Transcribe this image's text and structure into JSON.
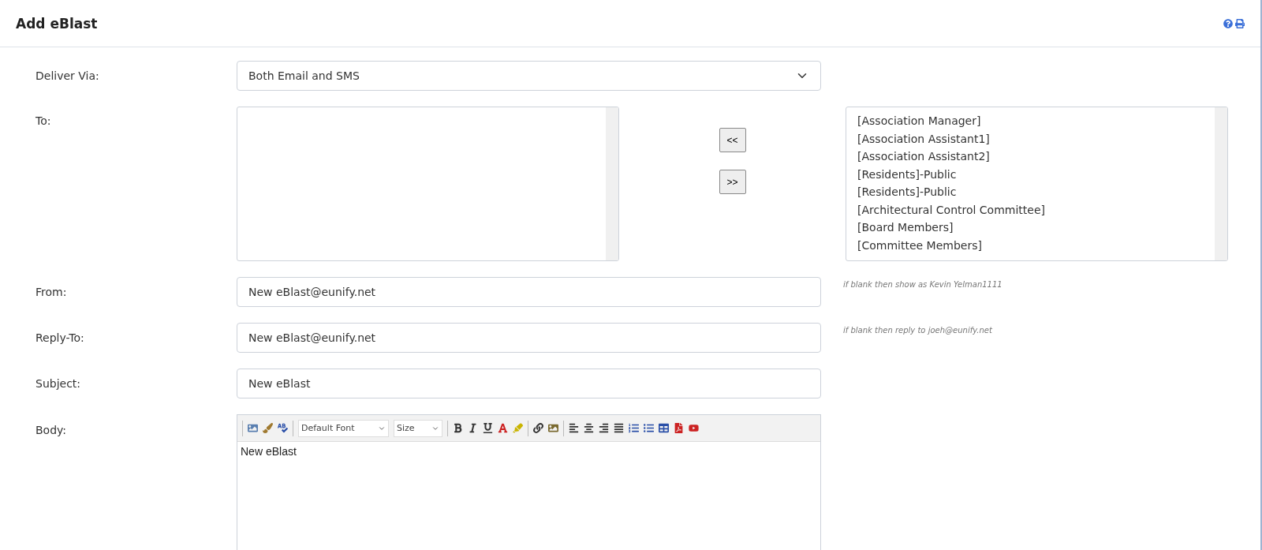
{
  "header": {
    "title": "Add eBlast"
  },
  "form": {
    "deliver_via": {
      "label": "Deliver Via:",
      "value": "Both Email and SMS"
    },
    "to": {
      "label": "To:",
      "move_left": "<<",
      "move_right": ">>",
      "available": [
        {
          "label": "[Association Manager]",
          "selected": false
        },
        {
          "label": "[Association Assistant1]",
          "selected": false
        },
        {
          "label": "[Association Assistant2]",
          "selected": false
        },
        {
          "label": "[Residents]-Public",
          "selected": false
        },
        {
          "label": "[Residents]-Public",
          "selected": false
        },
        {
          "label": "[Architectural Control Committee]",
          "selected": false
        },
        {
          "label": "[Board Members]",
          "selected": false
        },
        {
          "label": "[Committee Members]",
          "selected": false
        }
      ]
    },
    "from": {
      "label": "From:",
      "value": "New eBlast@eunify.net",
      "hint": "if blank then show as Kevin Yelman1111"
    },
    "reply_to": {
      "label": "Reply-To:",
      "value": "New eBlast@eunify.net",
      "hint": "if blank then reply to joeh@eunify.net"
    },
    "subject": {
      "label": "Subject:",
      "value": "New eBlast"
    },
    "body": {
      "label": "Body:",
      "font": "Default Font",
      "size": "Size",
      "text": "New eBlast"
    }
  }
}
